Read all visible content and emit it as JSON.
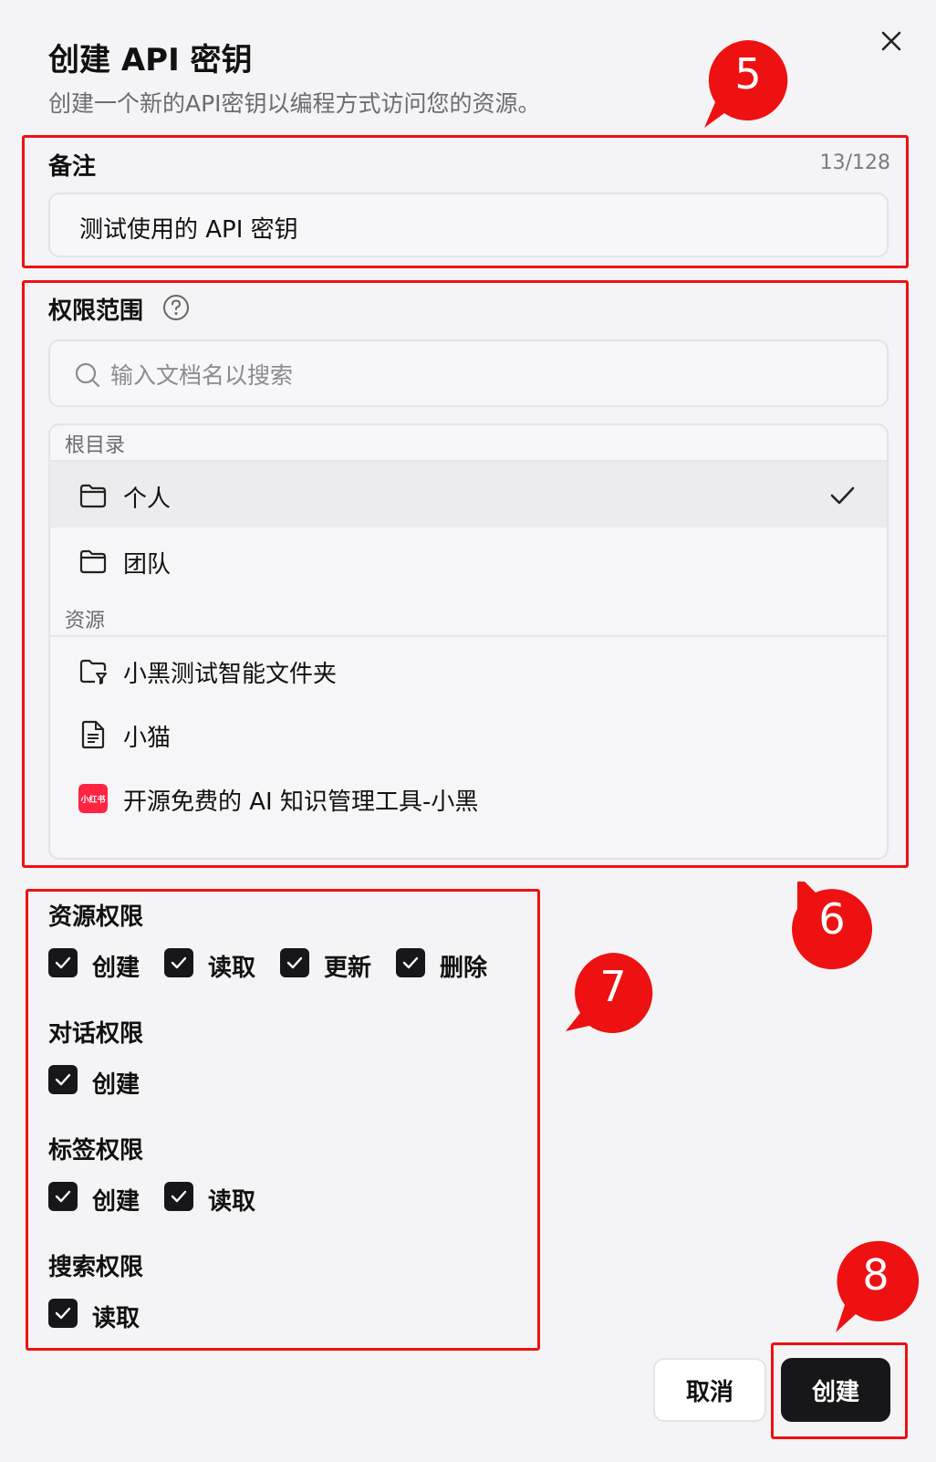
{
  "dialog": {
    "title": "创建 API 密钥",
    "subtitle": "创建一个新的API密钥以编程方式访问您的资源。"
  },
  "note": {
    "label": "备注",
    "counter": "13/128",
    "value": "测试使用的 API 密钥"
  },
  "scope": {
    "label": "权限范围",
    "search_placeholder": "输入文档名以搜索",
    "root_header": "根目录",
    "root_items": [
      {
        "label": "个人",
        "icon": "folder-icon",
        "selected": true
      },
      {
        "label": "团队",
        "icon": "folder-icon",
        "selected": false
      }
    ],
    "resource_header": "资源",
    "resource_items": [
      {
        "label": "小黑测试智能文件夹",
        "icon": "smart-folder-icon"
      },
      {
        "label": "小猫",
        "icon": "document-icon"
      },
      {
        "label": "开源免费的 AI 知识管理工具-小黑",
        "icon": "xiaohongshu-logo-icon",
        "logo_text": "小红书"
      }
    ]
  },
  "permissions": {
    "resource": {
      "label": "资源权限",
      "options": [
        "创建",
        "读取",
        "更新",
        "删除"
      ]
    },
    "chat": {
      "label": "对话权限",
      "options": [
        "创建"
      ]
    },
    "tag": {
      "label": "标签权限",
      "options": [
        "创建",
        "读取"
      ]
    },
    "search": {
      "label": "搜索权限",
      "options": [
        "读取"
      ]
    }
  },
  "buttons": {
    "cancel": "取消",
    "create": "创建"
  },
  "callouts": [
    "5",
    "6",
    "7",
    "8"
  ],
  "colors": {
    "annotation_red": "#ee1111",
    "primary_button": "#17171a",
    "logo_red": "#ff2442"
  }
}
